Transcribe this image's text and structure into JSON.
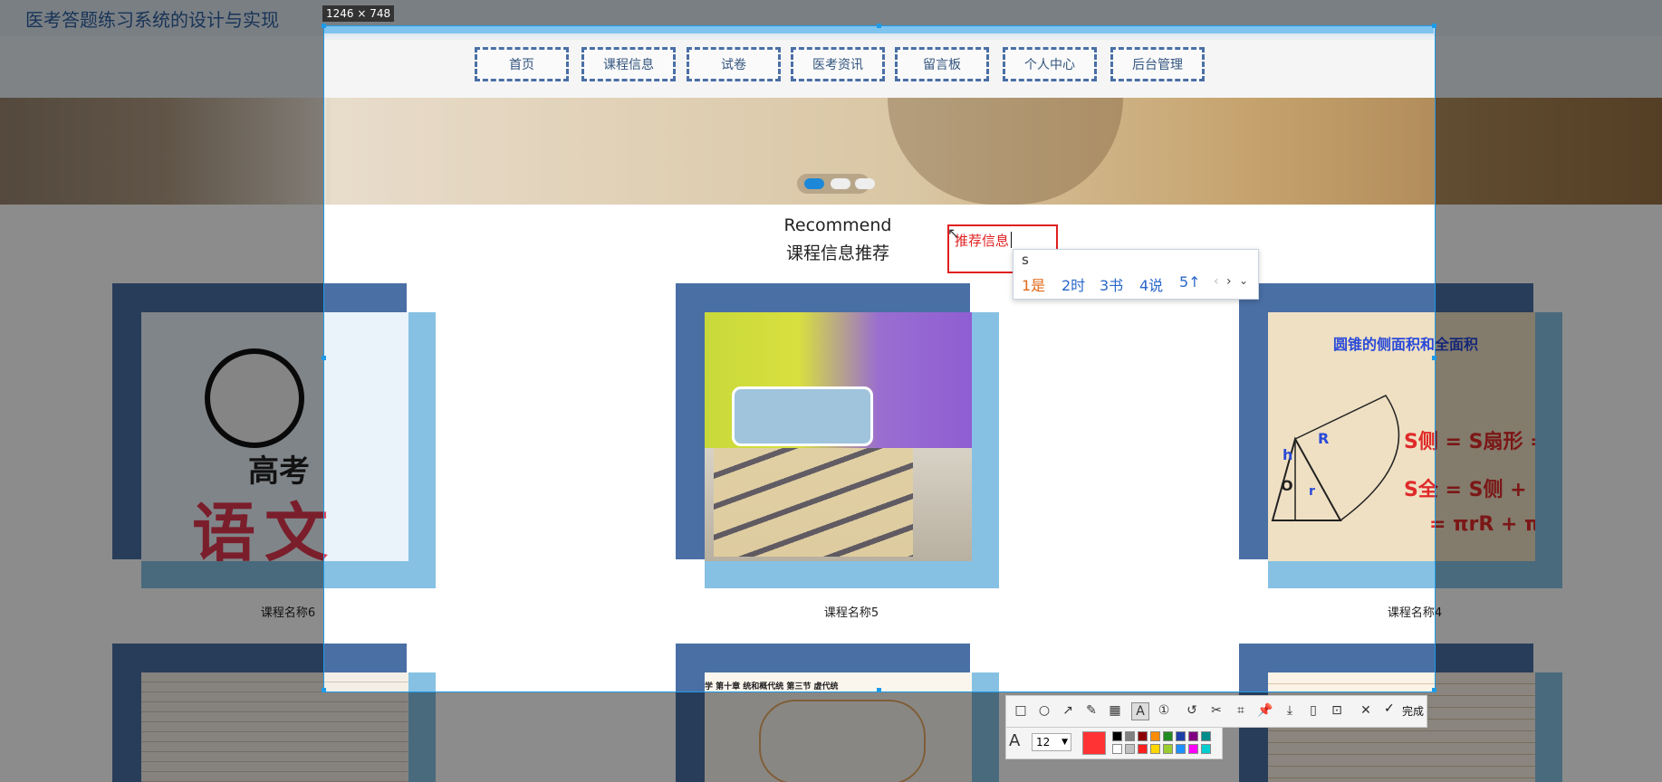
{
  "app_title": "医考答题练习系统的设计与实现",
  "capture": {
    "size_label": "1246 × 748"
  },
  "nav": {
    "items": [
      "首页",
      "课程信息",
      "试卷",
      "医考资讯",
      "留言板",
      "个人中心",
      "后台管理"
    ]
  },
  "recommend": {
    "title_en": "Recommend",
    "title_cn": "课程信息推荐"
  },
  "courses": {
    "row1": [
      "课程名称6",
      "课程名称5",
      "课程名称4"
    ]
  },
  "card_texts": {
    "card1_top": "高考",
    "card1_big": "语文",
    "card3_title": "圆锥的侧面积和全面积",
    "card3_formula1": "S侧 = S扇形 = π",
    "card3_formula2": "S全 = S侧 + S底",
    "card3_formula3": "= πrR + π",
    "card3_R": "R",
    "card3_h": "h",
    "card3_O": "O",
    "card3_r": "r",
    "card_mid_bottom": "学 第十章 统和概代统 第三节 虚代统"
  },
  "annotation": {
    "text": "推荐信息"
  },
  "ime": {
    "input": "s",
    "candidates": [
      "1是",
      "2时",
      "3书",
      "4说",
      "5↑"
    ]
  },
  "toolbar": {
    "done_label": "完成",
    "font_size": "12",
    "current_color": "#ff3333"
  },
  "colors": {
    "accent": "#1e9be8",
    "nav_border": "#4a6fa5",
    "annotation": "#e02020"
  }
}
